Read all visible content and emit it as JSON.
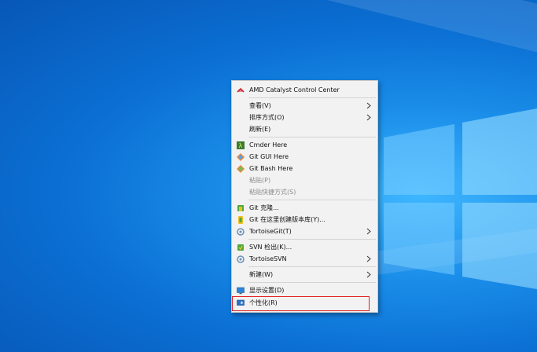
{
  "menu": {
    "items": [
      {
        "label": "AMD Catalyst Control Center",
        "icon": "amd-icon"
      },
      {
        "label": "查看(V)",
        "icon": "",
        "submenu": true
      },
      {
        "label": "排序方式(O)",
        "icon": "",
        "submenu": true
      },
      {
        "label": "刷新(E)",
        "icon": ""
      },
      {
        "label": "Cmder Here",
        "icon": "cmder-icon"
      },
      {
        "label": "Git GUI Here",
        "icon": "git-gui-icon"
      },
      {
        "label": "Git Bash Here",
        "icon": "git-bash-icon"
      },
      {
        "label": "粘贴(P)",
        "icon": "",
        "disabled": true
      },
      {
        "label": "粘贴快捷方式(S)",
        "icon": "",
        "disabled": true
      },
      {
        "label": "Git 克隆...",
        "icon": "tortoisegit-clone-icon"
      },
      {
        "label": "Git 在这里创建版本库(Y)...",
        "icon": "tortoisegit-create-repo-icon"
      },
      {
        "label": "TortoiseGit(T)",
        "icon": "tortoisegit-icon",
        "submenu": true
      },
      {
        "label": "SVN 检出(K)...",
        "icon": "svn-checkout-icon"
      },
      {
        "label": "TortoiseSVN",
        "icon": "tortoisesvn-icon",
        "submenu": true
      },
      {
        "label": "新建(W)",
        "icon": "",
        "submenu": true
      },
      {
        "label": "显示设置(D)",
        "icon": "display-settings-icon"
      },
      {
        "label": "个性化(R)",
        "icon": "personalize-icon",
        "highlighted": true
      }
    ]
  },
  "colors": {
    "desktop": "#0b6fd3",
    "highlight_border": "#e02020",
    "menu_bg": "#f2f2f2"
  }
}
